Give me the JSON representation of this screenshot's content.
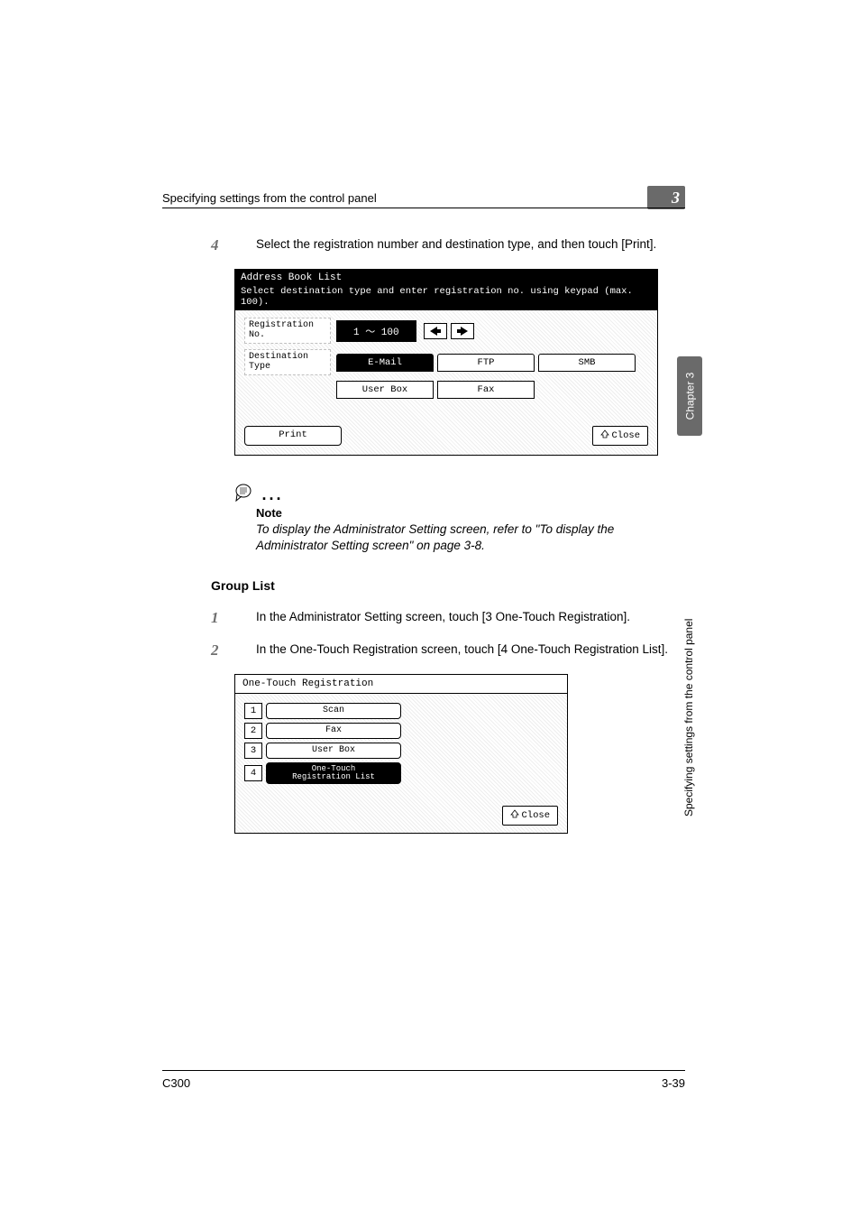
{
  "header": {
    "running_title": "Specifying settings from the control panel",
    "chapter_number": "3"
  },
  "sidebar": {
    "chapter_label": "Chapter 3",
    "section_label": "Specifying settings from the control panel"
  },
  "step4": {
    "num": "4",
    "text": "Select the registration number and destination type, and then touch [Print]."
  },
  "screenshot1": {
    "title": "Address Book List",
    "subtitle": "Select destination type and enter registration no. using keypad (max. 100).",
    "reg_label": "Registration\nNo.",
    "reg_range": "1  ～  100",
    "dest_label": "Destination\nType",
    "tabs": {
      "email": "E-Mail",
      "ftp": "FTP",
      "smb": "SMB",
      "userbox": "User Box",
      "fax": "Fax"
    },
    "print": "Print",
    "close": "Close"
  },
  "note": {
    "label": "Note",
    "body": "To display the Administrator Setting screen, refer to \"To display the Administrator Setting screen\" on page 3-8."
  },
  "group_list_heading": "Group List",
  "step1": {
    "num": "1",
    "text": "In the Administrator Setting screen, touch [3 One-Touch Registration]."
  },
  "step2": {
    "num": "2",
    "text": "In the One-Touch Registration screen, touch [4 One-Touch Registration List]."
  },
  "screenshot2": {
    "title": "One-Touch Registration",
    "items": {
      "i1": "Scan",
      "i2": "Fax",
      "i3": "User Box",
      "i4": "One-Touch\nRegistration List"
    },
    "nums": {
      "n1": "1",
      "n2": "2",
      "n3": "3",
      "n4": "4"
    },
    "close": "Close"
  },
  "footer": {
    "model": "C300",
    "page": "3-39"
  }
}
